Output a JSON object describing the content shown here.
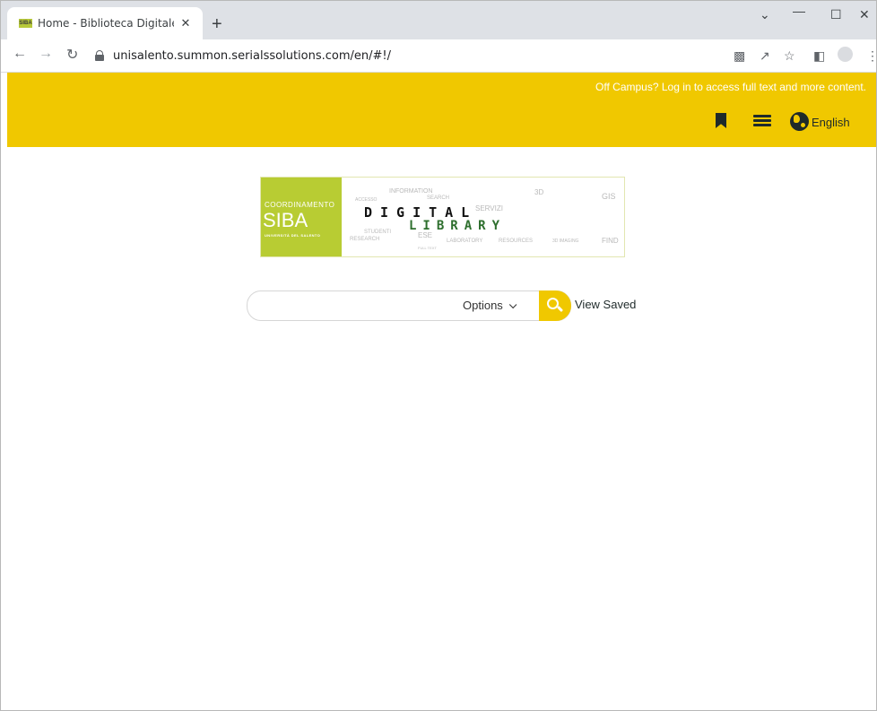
{
  "browser": {
    "tab_title": "Home - Biblioteca Digitale dell'Università",
    "tab_favicon_text": "SIBA",
    "url": "unisalento.summon.serialssolutions.com/en/#!/",
    "new_tab_glyph": "+",
    "close_glyph": "✕"
  },
  "header": {
    "off_campus_text": "Off Campus? Log in to access full text and more content.",
    "language_label": "English",
    "accent_color": "#f0c800"
  },
  "logo": {
    "coordinamento": "COORDINAMENTO",
    "siba": "SIBA",
    "university": "UNIVERSITÀ DEL SALENTO",
    "digital": "DIGITAL",
    "library": "LIBRARY",
    "cloud_words": [
      "INFORMATION",
      "SEARCH",
      "ACCESSO",
      "SERVIZI",
      "RESEARCH",
      "STUDENTI",
      "ESE",
      "LABORATORY",
      "RESOURCES",
      "3D",
      "FULL TEXT",
      "FIND",
      "GIS",
      "3D IMAGING"
    ]
  },
  "search": {
    "placeholder": "",
    "options_label": "Options",
    "view_saved_label": "View Saved"
  }
}
